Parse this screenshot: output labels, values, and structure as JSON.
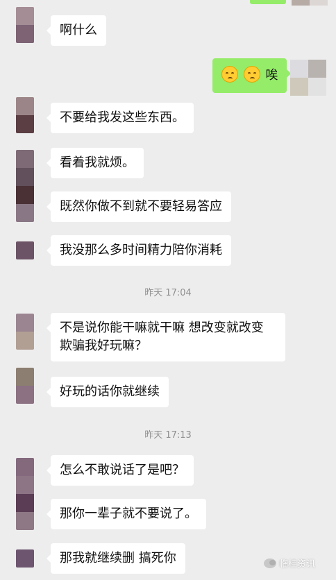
{
  "chat": {
    "messages": [
      {
        "side": "in",
        "text": "啊什么"
      },
      {
        "side": "out",
        "text": "唉",
        "emojis": [
          "pensive-face",
          "pensive-face"
        ]
      },
      {
        "side": "in",
        "text": "不要给我发这些东西。"
      },
      {
        "side": "in",
        "text": "看着我就烦。"
      },
      {
        "side": "in",
        "text": "既然你做不到就不要轻易答应"
      },
      {
        "side": "in",
        "text": "我没那么多时间精力陪你消耗"
      },
      {
        "side": "in",
        "text": "不是说你能干嘛就干嘛 想改变就改变 欺骗我好玩嘛？"
      },
      {
        "side": "in",
        "text": "好玩的话你就继续"
      },
      {
        "side": "in",
        "text": "怎么不敢说话了是吧？"
      },
      {
        "side": "in",
        "text": "那你一辈子就不要说了。"
      },
      {
        "side": "in",
        "text": "那我就继续删 搞死你"
      }
    ],
    "timestamps": [
      "昨天 17:04",
      "昨天 17:13"
    ]
  },
  "watermark": {
    "text": "临桂资讯",
    "icon": "wechat-logo-icon"
  },
  "colors": {
    "background": "#ededed",
    "incoming_bubble": "#ffffff",
    "outgoing_bubble": "#95ec69",
    "timestamp": "#8f8f8f"
  }
}
